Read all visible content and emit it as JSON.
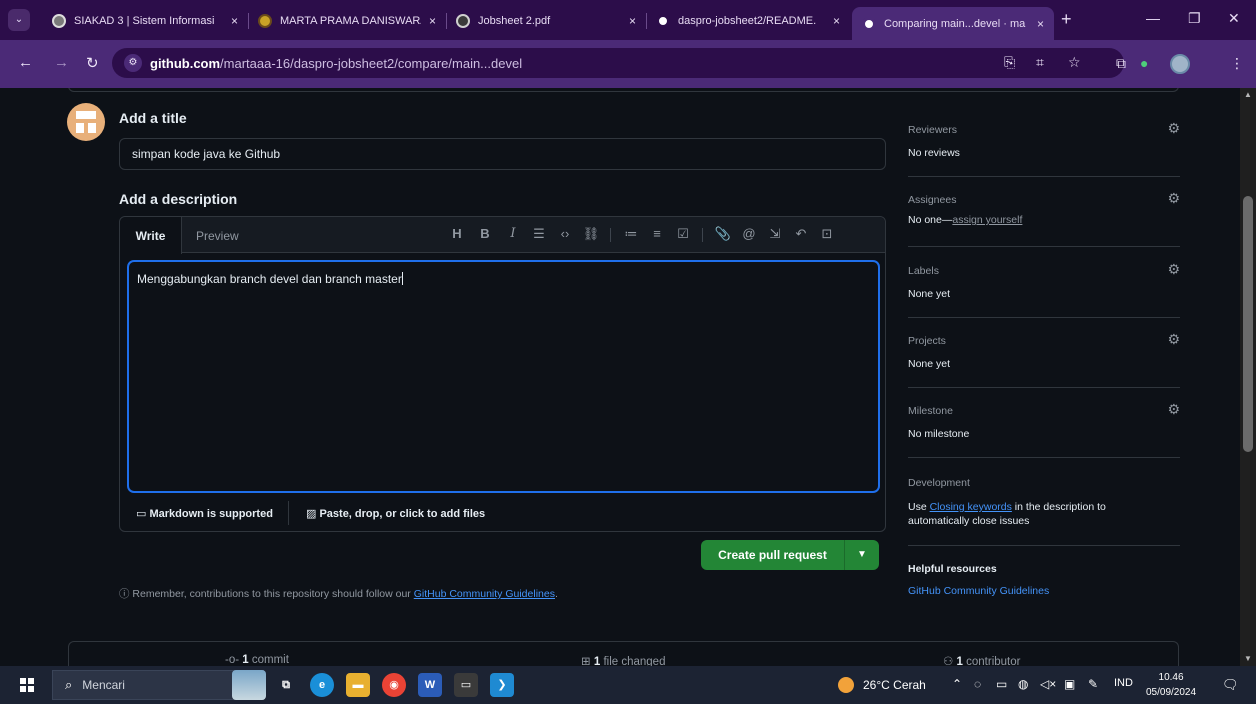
{
  "browser": {
    "tabs": [
      {
        "title": "SIAKAD 3 | Sistem Informasi",
        "close": "×",
        "color": "#7a7a7a"
      },
      {
        "title": "MARTA PRAMA DANISWARA",
        "close": "×",
        "color": "#c9a227"
      },
      {
        "title": "Jobsheet 2.pdf",
        "close": "×",
        "color": "#5a5a5a"
      },
      {
        "title": "daspro-jobsheet2/README.",
        "close": "×",
        "color": "#ffffff"
      },
      {
        "title": "Comparing main...devel · ma",
        "close": "×",
        "color": "#ffffff"
      }
    ],
    "new_tab": "+",
    "url_host": "github.com",
    "url_path": "/martaaa-16/daspro-jobsheet2/compare/main...devel"
  },
  "form": {
    "title_label": "Add a title",
    "title_value": "simpan kode java ke Github",
    "description_label": "Add a description",
    "tab_write": "Write",
    "tab_preview": "Preview",
    "description_value": "Menggabungkan branch devel dan branch master",
    "markdown_note": "Markdown is supported",
    "attach_note": "Paste, drop, or click to add files",
    "create_button": "Create pull request",
    "remember_prefix": "Remember, contributions to this repository should follow our ",
    "remember_link": "GitHub Community Guidelines",
    "remember_suffix": "."
  },
  "sidebar": {
    "reviewers": {
      "title": "Reviewers",
      "value": "No reviews"
    },
    "assignees": {
      "title": "Assignees",
      "value": "No one—",
      "link": "assign yourself"
    },
    "labels": {
      "title": "Labels",
      "value": "None yet"
    },
    "projects": {
      "title": "Projects",
      "value": "None yet"
    },
    "milestone": {
      "title": "Milestone",
      "value": "No milestone"
    },
    "development": {
      "title": "Development",
      "text_prefix": "Use ",
      "link": "Closing keywords",
      "text_suffix": " in the description to automatically close issues"
    },
    "helpful": {
      "title": "Helpful resources",
      "link": "GitHub Community Guidelines"
    }
  },
  "stats": {
    "commits_count": "1",
    "commits_label": "commit",
    "files_count": "1",
    "files_label": "file changed",
    "contributors_count": "1",
    "contributors_label": "contributor"
  },
  "taskbar": {
    "search_placeholder": "Mencari",
    "weather": "26°C  Cerah",
    "language": "IND",
    "time": "10.46",
    "date": "05/09/2024"
  }
}
